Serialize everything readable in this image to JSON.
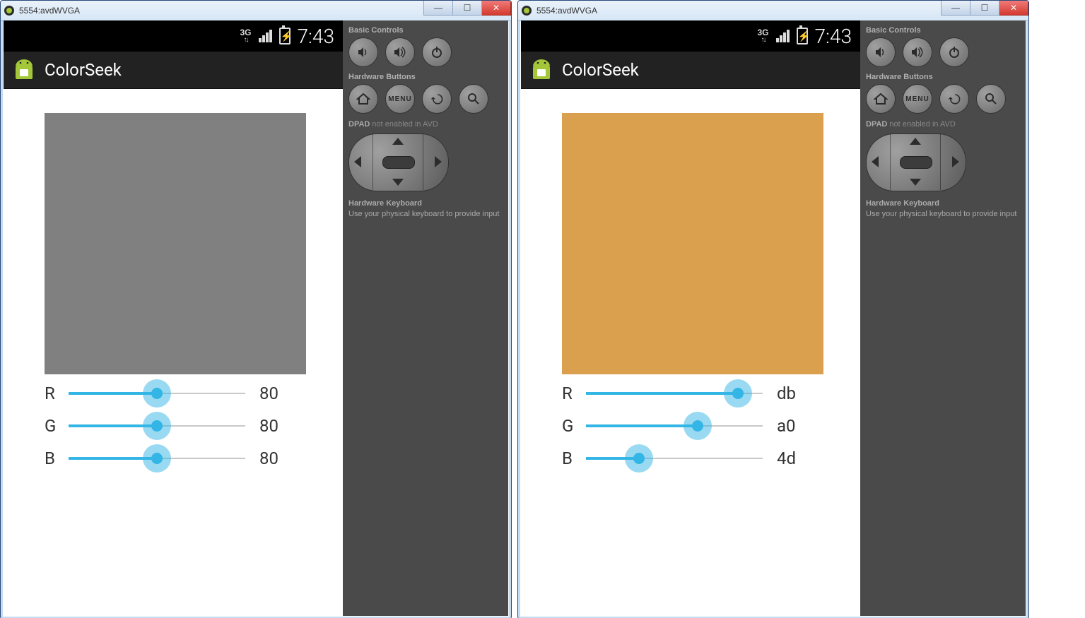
{
  "windows": [
    {
      "title": "5554:avdWVGA",
      "sidepanel": {
        "basic_label": "Basic Controls",
        "hw_buttons_label": "Hardware Buttons",
        "dpad_label": "DPAD",
        "dpad_note": "not enabled in AVD",
        "hw_kbd_label": "Hardware Keyboard",
        "hw_kbd_note": "Use your physical keyboard to provide input"
      },
      "status": {
        "clock": "7:43",
        "net": "3G"
      },
      "actionbar": {
        "title": "ColorSeek"
      },
      "app": {
        "swatch_color": "#808080",
        "r": {
          "label": "R",
          "value": "80",
          "percent": 50
        },
        "g": {
          "label": "G",
          "value": "80",
          "percent": 50
        },
        "b": {
          "label": "B",
          "value": "80",
          "percent": 50
        }
      }
    },
    {
      "title": "5554:avdWVGA",
      "sidepanel": {
        "basic_label": "Basic Controls",
        "hw_buttons_label": "Hardware Buttons",
        "dpad_label": "DPAD",
        "dpad_note": "not enabled in AVD",
        "hw_kbd_label": "Hardware Keyboard",
        "hw_kbd_note": "Use your physical keyboard to provide input"
      },
      "status": {
        "clock": "7:43",
        "net": "3G"
      },
      "actionbar": {
        "title": "ColorSeek"
      },
      "app": {
        "swatch_color": "#dba04d",
        "r": {
          "label": "R",
          "value": "db",
          "percent": 86
        },
        "g": {
          "label": "G",
          "value": "a0",
          "percent": 63
        },
        "b": {
          "label": "B",
          "value": "4d",
          "percent": 30
        }
      }
    }
  ]
}
